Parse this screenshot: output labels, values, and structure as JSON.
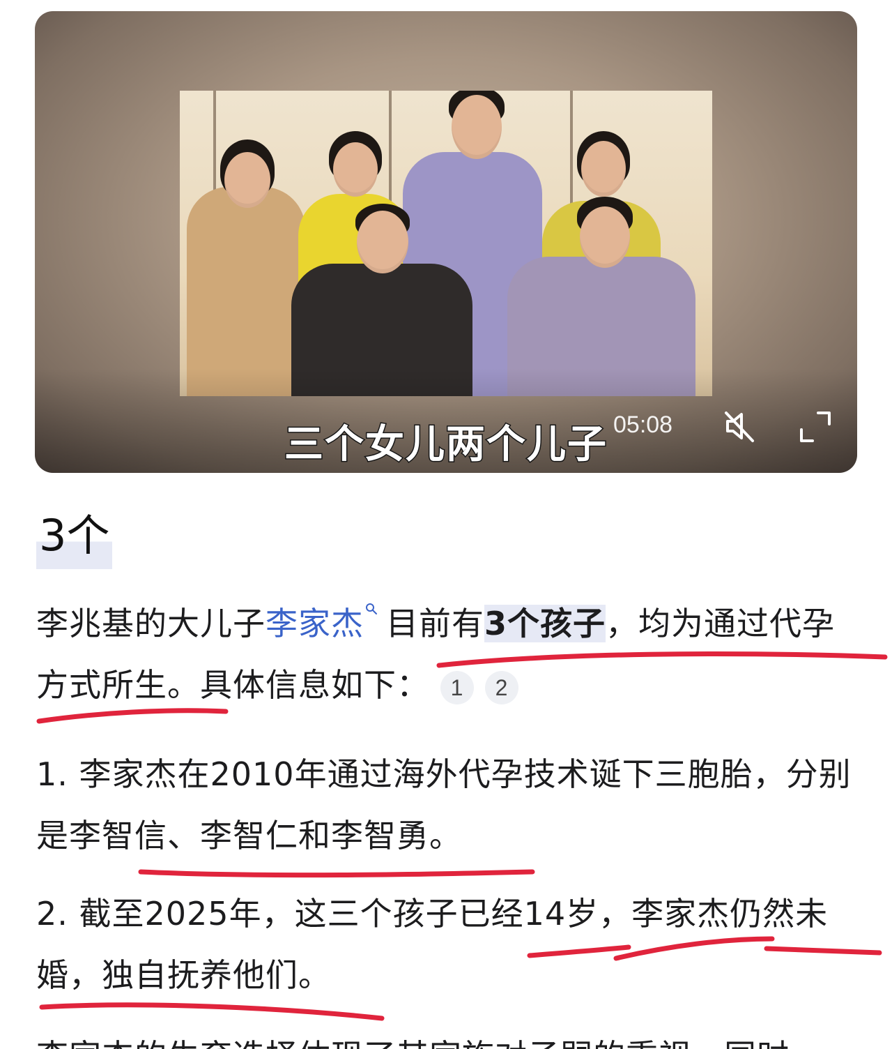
{
  "video": {
    "subtitle": "三个女儿两个儿子",
    "timecode": "05:08",
    "mute_icon": "speaker-muted-icon",
    "fullscreen_icon": "fullscreen-icon"
  },
  "answer": {
    "title": "3个",
    "p1": {
      "lead": "李兆基的大儿子",
      "link": "李家杰",
      "after_link": "目前有",
      "highlight": "3个孩子",
      "tail": "，均为通过代孕方式所生。具体信息如下：",
      "citations": [
        "1",
        "2"
      ]
    },
    "p2": "1. 李家杰在2010年通过海外代孕技术诞下三胞胎，分别是李智信、李智仁和李智勇。",
    "p3": "2. 截至2025年，这三个孩子已经14岁，李家杰仍然未婚，独自抚养他们。",
    "p4": "李家杰的生育选择体现了其家族对子嗣的重视，同时"
  },
  "colors": {
    "link": "#3a63c9",
    "highlight_bg": "#e6e9f5",
    "annotation_red": "#e0243c"
  }
}
